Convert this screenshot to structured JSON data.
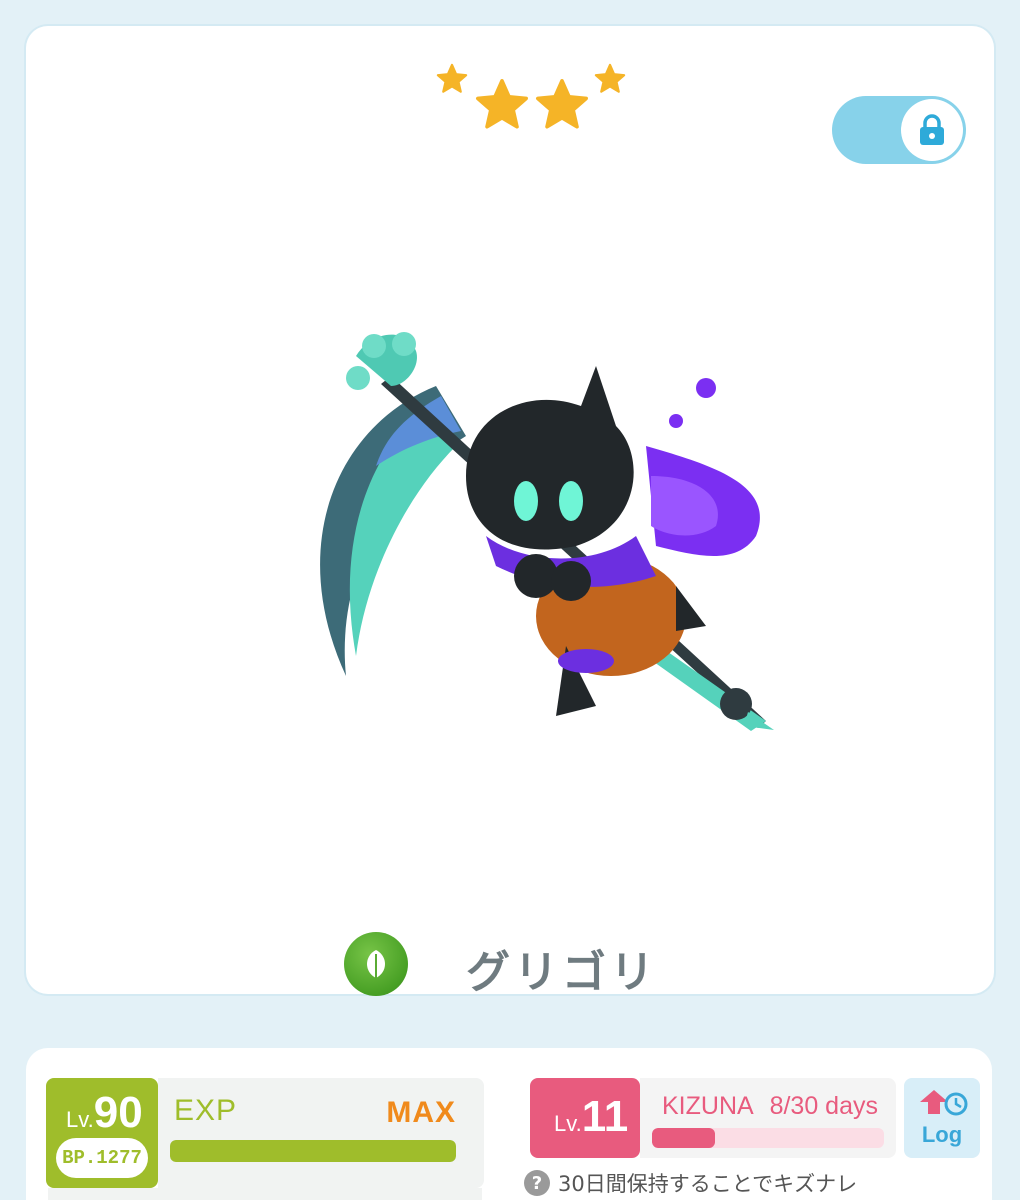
{
  "rarity": {
    "stars": 4,
    "star_color": "#f5b427"
  },
  "lock_toggle": {
    "state": "locked",
    "icon": "lock-icon",
    "color": "#87d2ea"
  },
  "character": {
    "name": "グリゴリ",
    "element_icon": "leaf-icon",
    "element_color": "#48a025"
  },
  "level": {
    "prefix": "Lv.",
    "value": "90",
    "bp": "BP.1277",
    "exp_label": "EXP",
    "exp_status": "MAX",
    "exp_progress": 1.0,
    "color": "#9fbd2b"
  },
  "kizuna": {
    "prefix": "Lv.",
    "value": "11",
    "label": "KIZUNA",
    "days": "8/30 days",
    "progress": 0.27,
    "color": "#e85b7e"
  },
  "log_button": {
    "label": "Log",
    "icon": "log-history-icon"
  },
  "hint": {
    "icon": "question-icon",
    "symbol": "?",
    "text": "30日間保持することでキズナレ"
  }
}
